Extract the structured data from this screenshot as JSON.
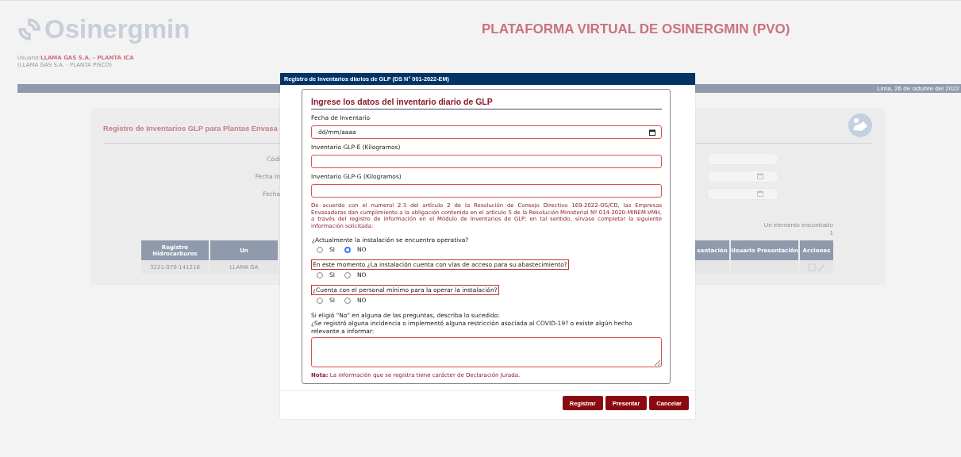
{
  "header": {
    "logo": "Osinergmin",
    "title": "PLATAFORMA VIRTUAL DE OSINERGMIN (PVO)",
    "user_label": "Usuario:",
    "user_name": "LLAMA GAS S.A. - PLANTA ICA",
    "user_alt": "(LLAMA GAS S.A. - PLANTA PISCO)"
  },
  "date_bar": "Lima, 26 de octubre del 2022",
  "background_card": {
    "title": "Registro de Inventarios GLP para Plantas Envasa",
    "filters": [
      {
        "label": "Códi",
        "kind": "text"
      },
      {
        "label": "Fecha In",
        "kind": "date"
      },
      {
        "label": "Fecha",
        "kind": "date"
      }
    ],
    "result_count": "Un elemento encontrado",
    "page": "1",
    "table": {
      "left_columns": [
        "Registro Hidrocarburos",
        "Un"
      ],
      "right_columns": [
        "sentación",
        "Usuario Presentación",
        "Acciones"
      ],
      "left_cells": [
        "3221-070-141216",
        "LLAMA GA"
      ]
    }
  },
  "modal": {
    "title": "Registro de Inventarios diarios de GLP (DS N° 001-2022-EM)",
    "heading": "Ingrese los datos del inventario diario de GLP",
    "fields": [
      {
        "label": "Fecha de Inventario",
        "kind": "date",
        "placeholder": "dd/mm/aaaa"
      },
      {
        "label": "Inventario GLP-E (Kilogramos)",
        "kind": "text"
      },
      {
        "label": "Inventario GLP-G (Kilogramos)",
        "kind": "text"
      }
    ],
    "notice": "De acuerdo con el numeral 2.3 del artículo 2 de la Resolución de Consejo Directivo 169-2022-OS/CD, las Empresas Envasadoras dan cumplimiento a la obligación contenida en el artículo 5 de la Resolución Ministerial Nº 014-2020-MINEM-VMH, a través del registro de información en el Módulo de Inventarios de GLP; en tal sentido, sírvase completar la siguiente información solicitada:",
    "questions": [
      {
        "text": "¿Actualmente la instalación se encuentra operativa?",
        "highlighted": false,
        "options": [
          {
            "label": "SI",
            "selected": false
          },
          {
            "label": "NO",
            "selected": true
          }
        ]
      },
      {
        "text": "En este momento ¿La instalación cuenta con vías de acceso para su abastecimiento?",
        "highlighted": true,
        "options": [
          {
            "label": "SI",
            "selected": false
          },
          {
            "label": "NO",
            "selected": false
          }
        ]
      },
      {
        "text": "¿Cuenta con el personal mínimo para la operar la instalación?",
        "highlighted": true,
        "options": [
          {
            "label": "SI",
            "selected": false
          },
          {
            "label": "NO",
            "selected": false
          }
        ]
      }
    ],
    "description_prompt": "Si eligió \"No\" en alguna de las preguntas, describa lo sucedido:",
    "description_question": "¿Se registró alguna incidencia o implementó alguna restricción asociada al COVID-19? o existe algún hecho relevante a informar:",
    "note": "**Nota:** La información que se registra tiene carácter de Declaración Jurada.",
    "buttons": [
      "Registrar",
      "Presentar",
      "Cancelar"
    ]
  }
}
